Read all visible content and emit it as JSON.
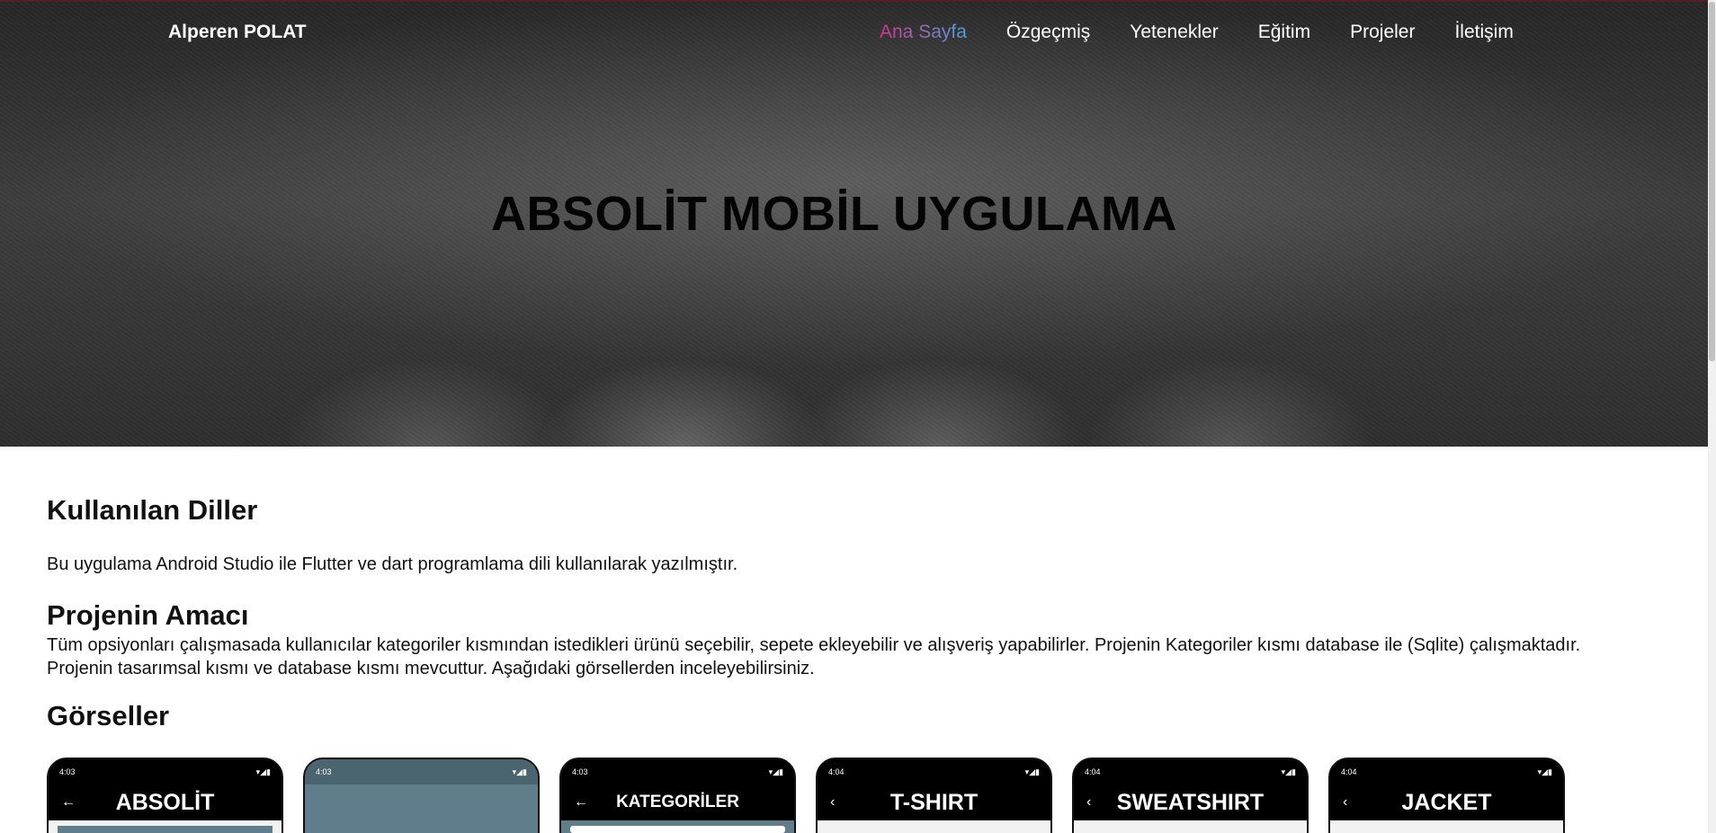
{
  "header": {
    "brand": "Alperen POLAT",
    "nav": [
      {
        "label": "Ana Sayfa",
        "active": true
      },
      {
        "label": "Özgeçmiş",
        "active": false
      },
      {
        "label": "Yetenekler",
        "active": false
      },
      {
        "label": "Eğitim",
        "active": false
      },
      {
        "label": "Projeler",
        "active": false
      },
      {
        "label": "İletişim",
        "active": false
      }
    ],
    "active_gradient": [
      "#d6338a",
      "#4aa3df"
    ]
  },
  "hero": {
    "title": "ABSOLİT MOBİL UYGULAMA"
  },
  "sections": {
    "diller_heading": "Kullanılan Diller",
    "diller_text": "Bu uygulama Android Studio ile Flutter ve dart programlama dili kullanılarak yazılmıştır.",
    "amac_heading": "Projenin Amacı",
    "amac_text": "Tüm opsiyonları çalışmasada kullanıcılar kategoriler kısmından istedikleri ürünü seçebilir, sepete ekleyebilir ve alışveriş yapabilirler. Projenin Kategoriler kısmı database ile (Sqlite) çalışmaktadır. Projenin tasarımsal kısmı ve database kısmı mevcuttur. Aşağıdaki görsellerden inceleyebilirsiniz.",
    "gorseller_heading": "Görseller"
  },
  "gallery": [
    {
      "time": "4:03",
      "title": "ABSOLİT"
    },
    {
      "time": "4:03",
      "title": ""
    },
    {
      "time": "4:03",
      "title": "KATEGORİLER"
    },
    {
      "time": "4:04",
      "title": "T-SHIRT"
    },
    {
      "time": "4:04",
      "title": "SWEATSHIRT"
    },
    {
      "time": "4:04",
      "title": "JACKET"
    }
  ]
}
